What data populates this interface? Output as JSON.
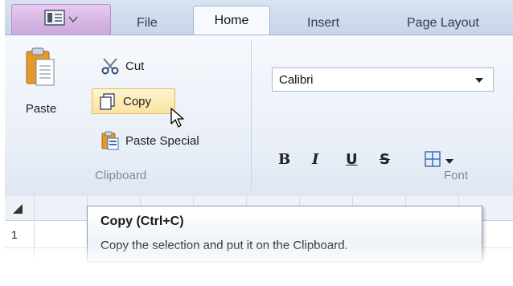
{
  "tabs": {
    "file": "File",
    "home": "Home",
    "insert": "Insert",
    "page_layout": "Page Layout"
  },
  "clipboard_group": {
    "paste": "Paste",
    "cut": "Cut",
    "copy": "Copy",
    "paste_special": "Paste Special",
    "label": "Clipboard"
  },
  "font_group": {
    "font_name": "Calibri",
    "bold": "B",
    "italic": "I",
    "underline": "U",
    "strikethrough": "S",
    "label": "Font"
  },
  "sheet": {
    "row_1": "1"
  },
  "tooltip": {
    "title": "Copy (Ctrl+C)",
    "description": "Copy the selection and put it on the Clipboard."
  },
  "icons": {
    "app_menu": "app-menu-icon",
    "paste": "clipboard-icon",
    "cut": "scissors-icon",
    "copy": "copy-icon",
    "paste_special": "paste-special-icon",
    "borders": "borders-icon",
    "cursor": "mouse-pointer-icon"
  },
  "colors": {
    "hover_fill": "#fbe3a0",
    "app_button": "#d6b4e2",
    "ribbon_bg": "#eef3f9"
  }
}
